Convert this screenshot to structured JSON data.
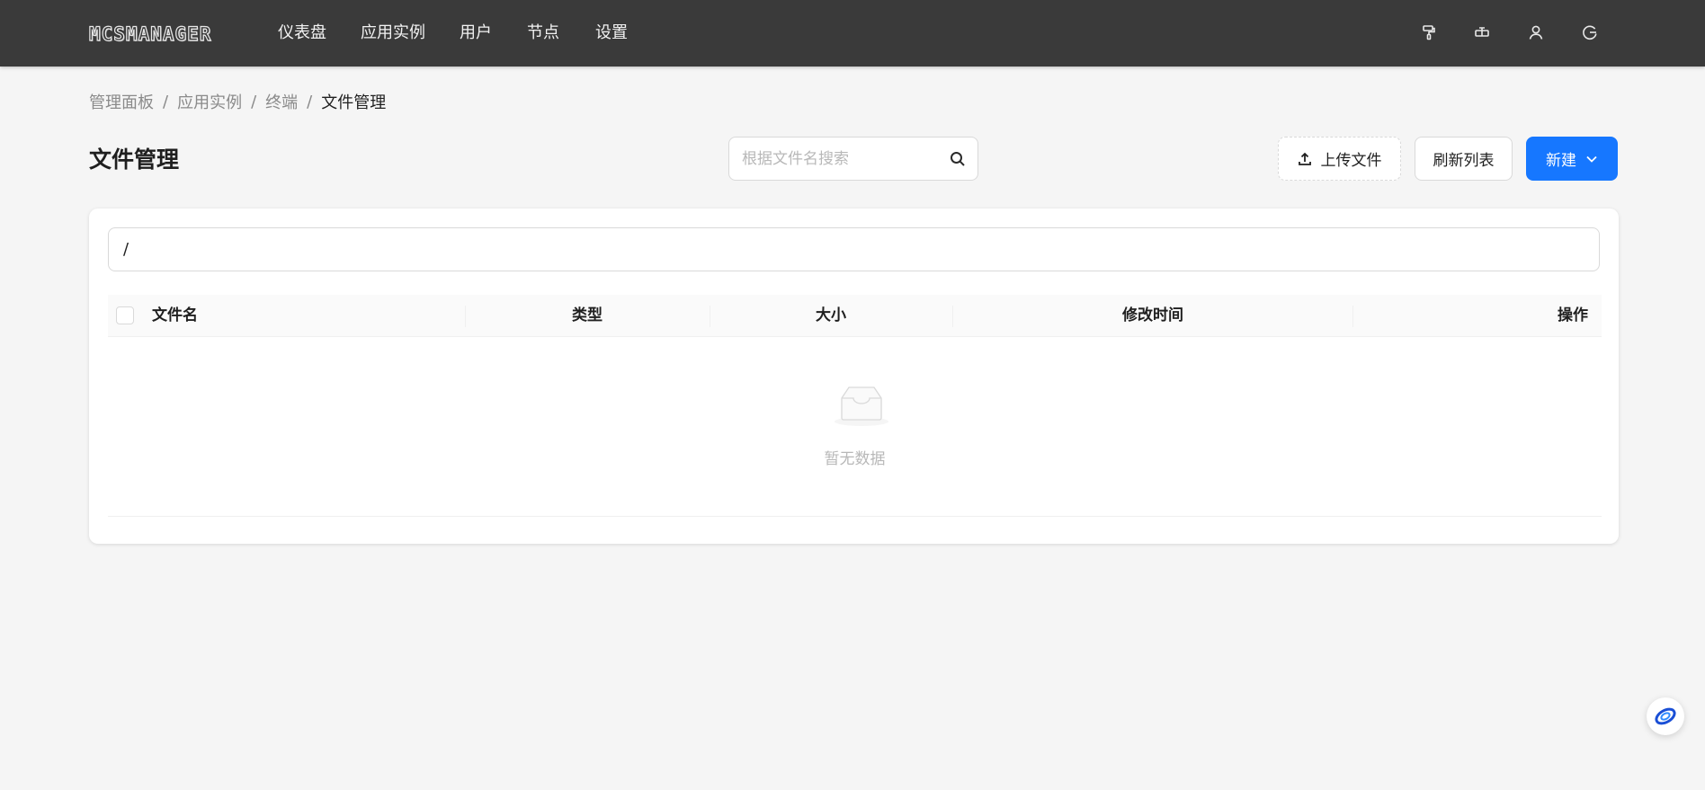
{
  "header": {
    "logo_text": "MCSMANAGER",
    "nav": [
      "仪表盘",
      "应用实例",
      "用户",
      "节点",
      "设置"
    ],
    "icons": [
      "paint-roller-icon",
      "layout-icon",
      "user-icon",
      "logout-icon"
    ]
  },
  "breadcrumb": [
    "管理面板",
    "应用实例",
    "终端",
    "文件管理"
  ],
  "breadcrumb_separator": "/",
  "page": {
    "title": "文件管理",
    "search_placeholder": "根据文件名搜索",
    "upload_label": "上传文件",
    "refresh_label": "刷新列表",
    "new_label": "新建"
  },
  "file_table": {
    "path": "/",
    "columns": [
      "文件名",
      "类型",
      "大小",
      "修改时间",
      "操作"
    ],
    "rows": [],
    "empty_text": "暂无数据"
  },
  "colors": {
    "header_bg": "#3a3a3a",
    "primary": "#1677ff",
    "page_bg": "#f5f5f5"
  }
}
